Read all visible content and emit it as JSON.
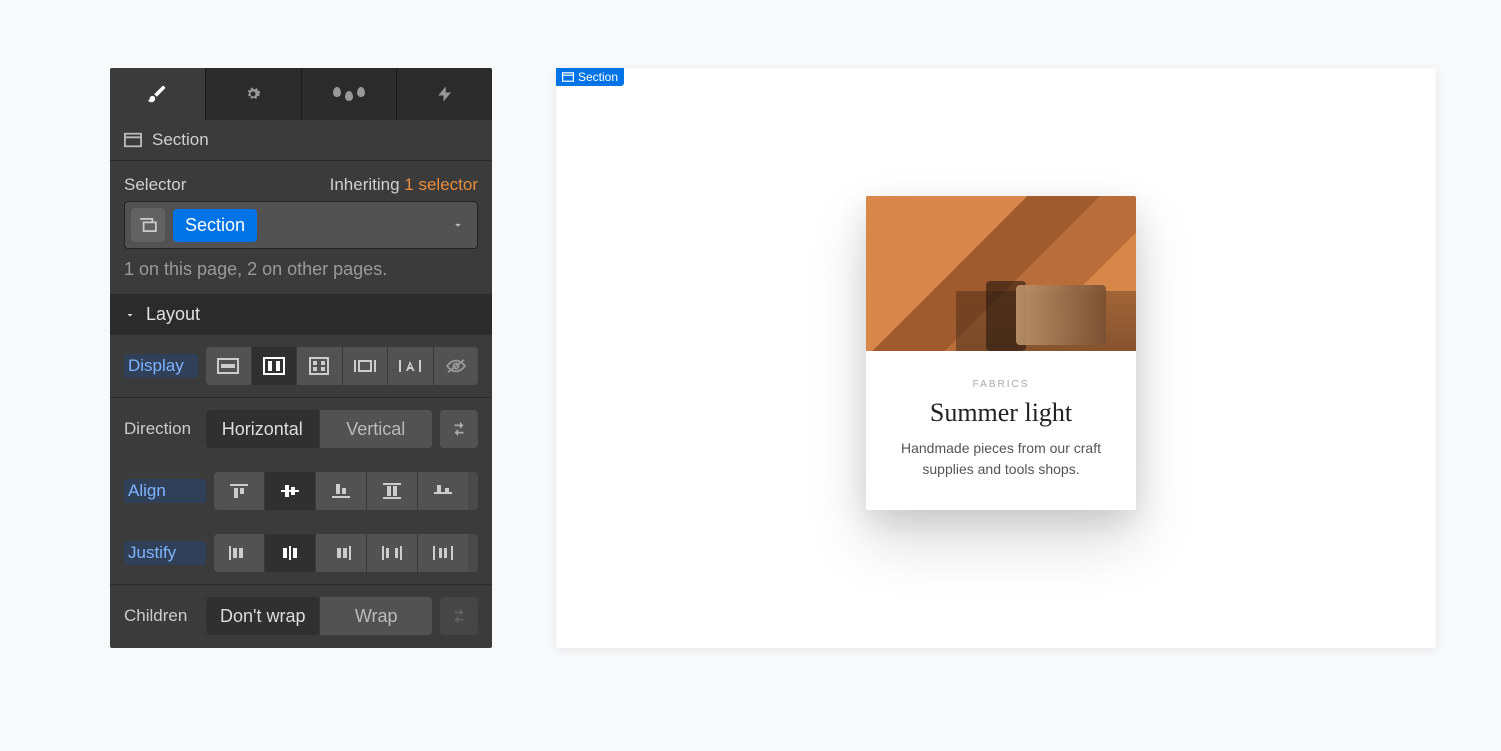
{
  "breadcrumb": {
    "element": "Section"
  },
  "selector": {
    "label": "Selector",
    "inheriting_prefix": "Inheriting",
    "inheriting_count": "1 selector",
    "class_name": "Section",
    "usage": "1 on this page, 2 on other pages."
  },
  "section_header": "Layout",
  "labels": {
    "display": "Display",
    "direction": "Direction",
    "align": "Align",
    "justify": "Justify",
    "children": "Children"
  },
  "direction": {
    "opt1": "Horizontal",
    "opt2": "Vertical"
  },
  "children": {
    "opt1": "Don't wrap",
    "opt2": "Wrap"
  },
  "canvas": {
    "tag": "Section",
    "card": {
      "category": "FABRICS",
      "title": "Summer light",
      "description": "Handmade pieces from our craft supplies and tools shops."
    }
  }
}
